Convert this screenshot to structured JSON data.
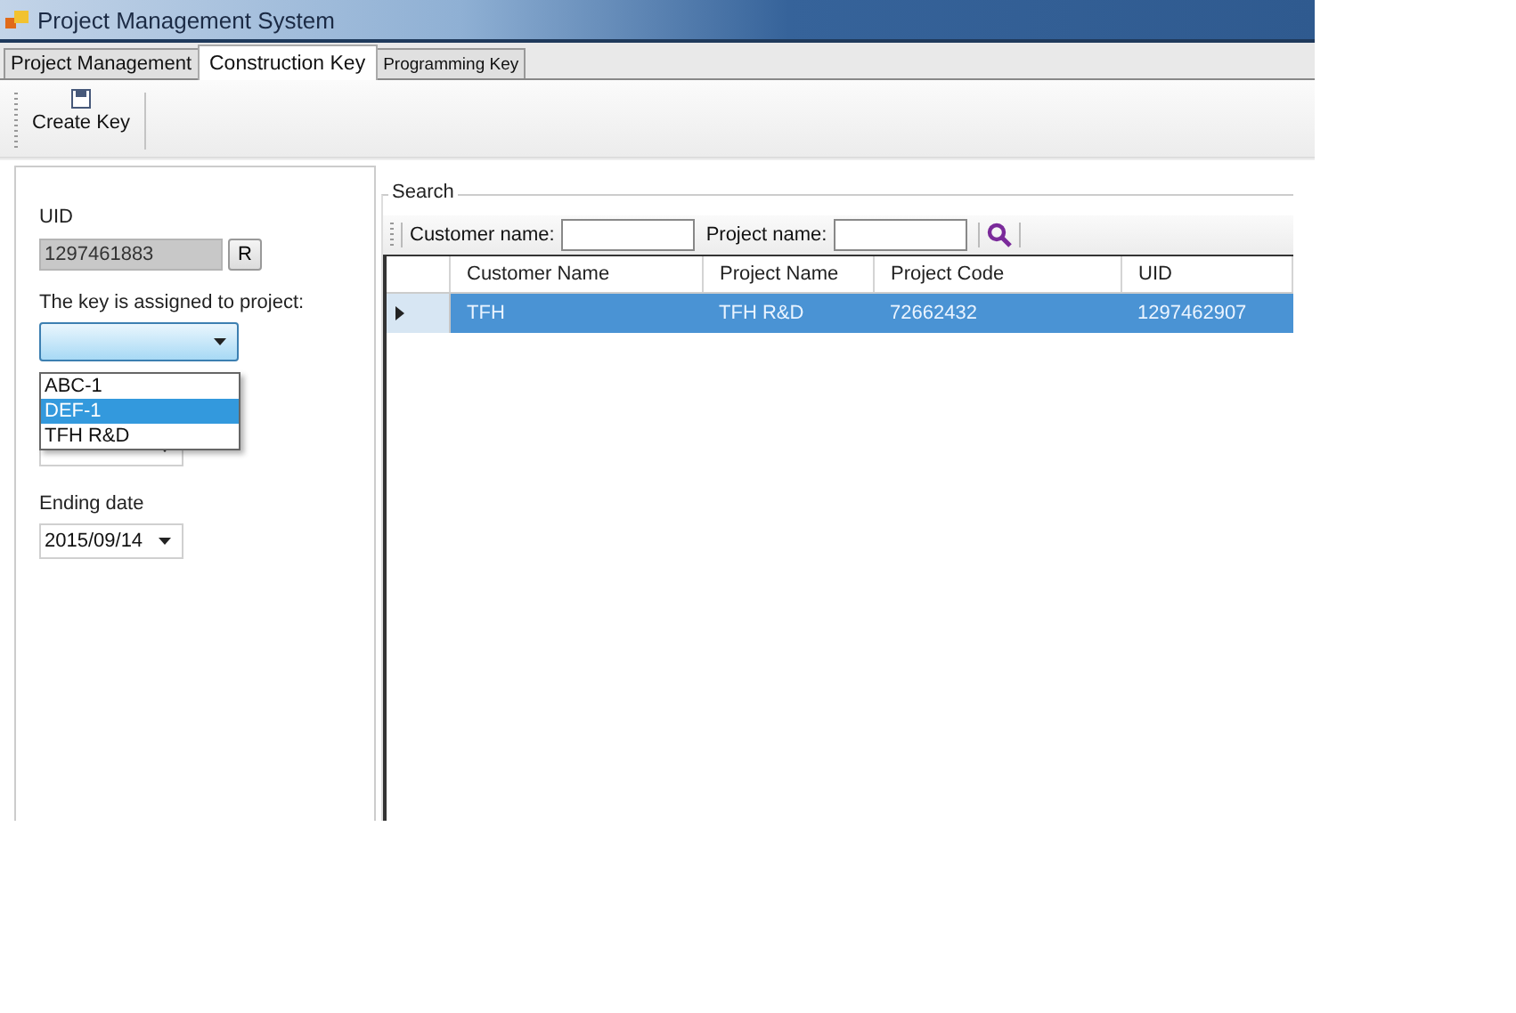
{
  "window": {
    "title": "Project Management System"
  },
  "tabs": [
    {
      "label": "Project Management",
      "selected": false
    },
    {
      "label": "Construction Key",
      "selected": true
    },
    {
      "label": "Programming Key",
      "selected": false
    }
  ],
  "toolbar": {
    "buttons": [
      {
        "label": "Create Key"
      }
    ]
  },
  "key_form": {
    "uid_label": "UID",
    "uid_value": "1297461883",
    "refresh_button": "R",
    "project_label": "The key is assigned to project:",
    "project_dropdown": {
      "expanded": true,
      "options": [
        {
          "label": "ABC-1",
          "selected": false
        },
        {
          "label": "DEF-1",
          "selected": true
        },
        {
          "label": "TFH R&D",
          "selected": false
        }
      ]
    },
    "ending_date_label": "Ending date",
    "ending_date": "2015/09/14"
  },
  "search": {
    "title": "Search",
    "fields": [
      {
        "label": "Customer name:"
      },
      {
        "label": "Project name:"
      }
    ]
  },
  "table": {
    "columns": [
      "Customer Name",
      "Project Name",
      "Project Code",
      "UID"
    ],
    "rows": [
      {
        "selected": true,
        "cells": [
          "TFH",
          "TFH R&D",
          "72662432",
          "1297462907"
        ]
      }
    ]
  }
}
